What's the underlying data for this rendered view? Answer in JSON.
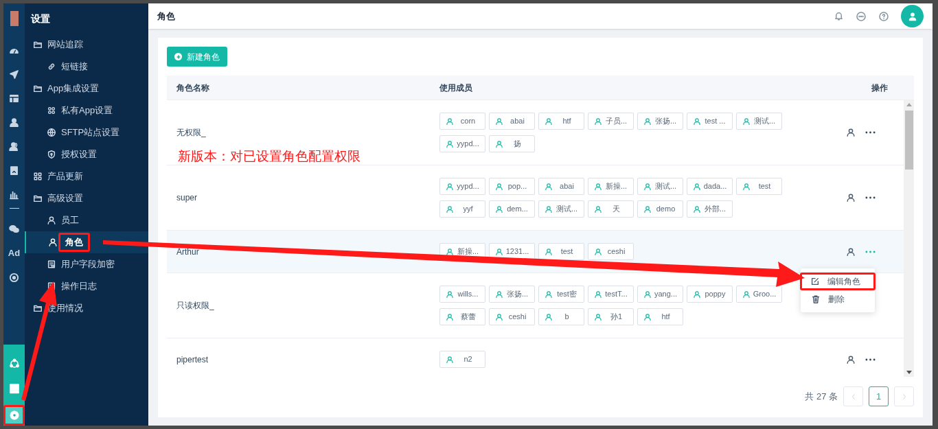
{
  "rail": {
    "label": "Ad",
    "bottom": [
      {
        "selected": false
      },
      {
        "selected": false
      },
      {
        "selected": true
      }
    ]
  },
  "sidebar": {
    "title": "设置",
    "items": [
      {
        "label": "网站追踪",
        "children": [
          {
            "label": "短链接",
            "selected": false
          }
        ]
      },
      {
        "label": "App集成设置",
        "children": [
          {
            "label": "私有App设置",
            "selected": false
          },
          {
            "label": "SFTP站点设置",
            "selected": false
          },
          {
            "label": "授权设置",
            "selected": false
          }
        ]
      },
      {
        "label": "产品更新",
        "selected": false
      },
      {
        "label": "高级设置",
        "children": [
          {
            "label": "员工",
            "selected": false
          },
          {
            "label": "角色",
            "selected": true
          },
          {
            "label": "用户字段加密",
            "selected": false
          },
          {
            "label": "操作日志",
            "selected": false
          }
        ]
      },
      {
        "label": "使用情况",
        "selected": false
      }
    ]
  },
  "header": {
    "title": "角色"
  },
  "new_button": "新建角色",
  "table": {
    "columns": [
      "角色名称",
      "使用成员",
      "操作"
    ],
    "rows": [
      {
        "name": "无权限_",
        "hovered": false,
        "menu_open": false,
        "members": [
          "corn",
          "abai",
          "htf",
          "子员...",
          "张扬...",
          "test ...",
          "测试...",
          "yypd...",
          "扬"
        ]
      },
      {
        "name": "super",
        "hovered": false,
        "menu_open": false,
        "members": [
          "yypd...",
          "pop...",
          "abai",
          "新操...",
          "测试...",
          "dada...",
          "test",
          "yyf",
          "dem...",
          "测试...",
          "天",
          "demo",
          "外部..."
        ]
      },
      {
        "name": "Arthur",
        "hovered": true,
        "menu_open": true,
        "members": [
          "新操...",
          "1231...",
          "test",
          "ceshi"
        ]
      },
      {
        "name": "只读权限_",
        "hovered": false,
        "members": [
          "wills...",
          "张扬...",
          "test密",
          "testT...",
          "yang...",
          "poppy",
          "Groo...",
          "蔡蕾",
          "ceshi",
          "b",
          "孙1",
          "htf"
        ]
      },
      {
        "name": "pipertest",
        "hovered": false,
        "menu_open": false,
        "members": [
          "n2"
        ]
      }
    ]
  },
  "menu": [
    {
      "label": "编辑角色",
      "kind": "edit",
      "boxed": true
    },
    {
      "label": "删除",
      "kind": "delete",
      "boxed": false
    }
  ],
  "pagination": {
    "total": "共 27 条",
    "pages": [
      {
        "label": "1",
        "selected": true
      }
    ]
  },
  "annotation": {
    "text": "新版本：对已设置角色配置权限"
  }
}
